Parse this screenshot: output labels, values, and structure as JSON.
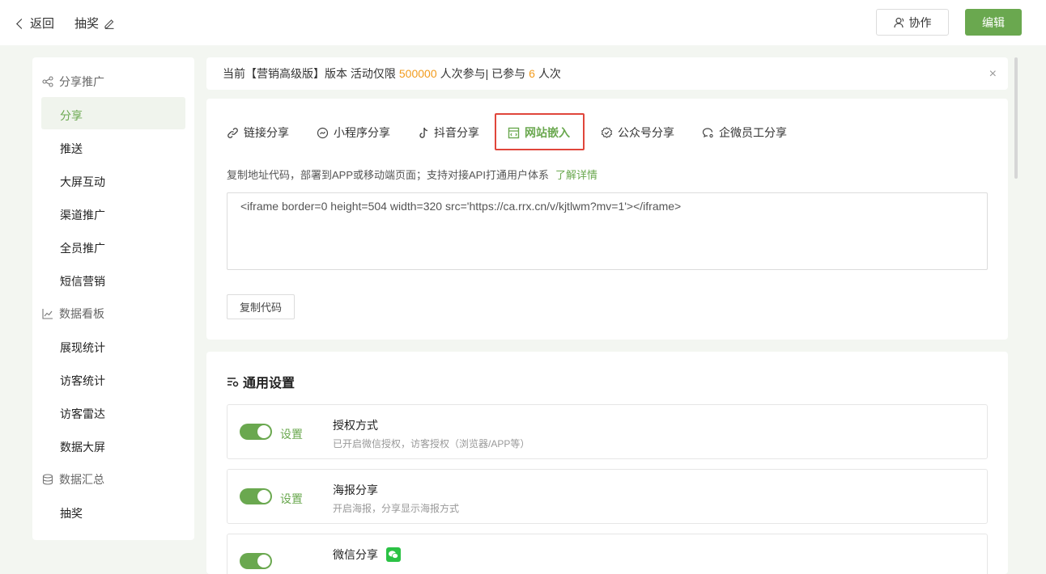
{
  "header": {
    "back_label": "返回",
    "title": "抽奖",
    "collab_label": "协作",
    "edit_label": "编辑"
  },
  "sidebar": {
    "groups": [
      {
        "label": "分享推广",
        "icon": "share-icon",
        "items": [
          "分享",
          "推送",
          "大屏互动",
          "渠道推广",
          "全员推广",
          "短信营销"
        ]
      },
      {
        "label": "数据看板",
        "icon": "line-chart-icon",
        "items": [
          "展现统计",
          "访客统计",
          "访客雷达",
          "数据大屏"
        ]
      },
      {
        "label": "数据汇总",
        "icon": "database-icon",
        "items": [
          "抽奖"
        ]
      }
    ],
    "active_item": "分享"
  },
  "notice": {
    "prefix": "当前【营销高级版】版本 活动仅限",
    "limit": "500000",
    "middle": "人次参与| 已参与",
    "count": "6",
    "suffix": "人次"
  },
  "share": {
    "tabs": [
      {
        "label": "链接分享",
        "icon": "link-icon"
      },
      {
        "label": "小程序分享",
        "icon": "miniprogram-icon"
      },
      {
        "label": "抖音分享",
        "icon": "douyin-icon"
      },
      {
        "label": "网站嵌入",
        "icon": "embed-icon"
      },
      {
        "label": "公众号分享",
        "icon": "official-account-icon"
      },
      {
        "label": "企微员工分享",
        "icon": "wecom-icon"
      }
    ],
    "active_tab": "网站嵌入",
    "description": "复制地址代码，部署到APP或移动端页面；支持对接API打通用户体系",
    "learn_more": "了解详情",
    "code": "<iframe border=0 height=504 width=320 src='https://ca.rrx.cn/v/kjtlwm?mv=1'></iframe>",
    "copy_label": "复制代码"
  },
  "settings": {
    "title": "通用设置",
    "rows": [
      {
        "switch_on": true,
        "set_label": "设置",
        "title": "授权方式",
        "desc": "已开启微信授权，访客授权（浏览器/APP等）"
      },
      {
        "switch_on": true,
        "set_label": "设置",
        "title": "海报分享",
        "desc": "开启海报，分享显示海报方式"
      },
      {
        "switch_on": true,
        "set_label": "",
        "title": "微信分享",
        "desc": ""
      }
    ]
  },
  "colors": {
    "accent": "#6aa84f",
    "highlight": "#f29b1c",
    "active_tab_border": "#e0463b"
  }
}
